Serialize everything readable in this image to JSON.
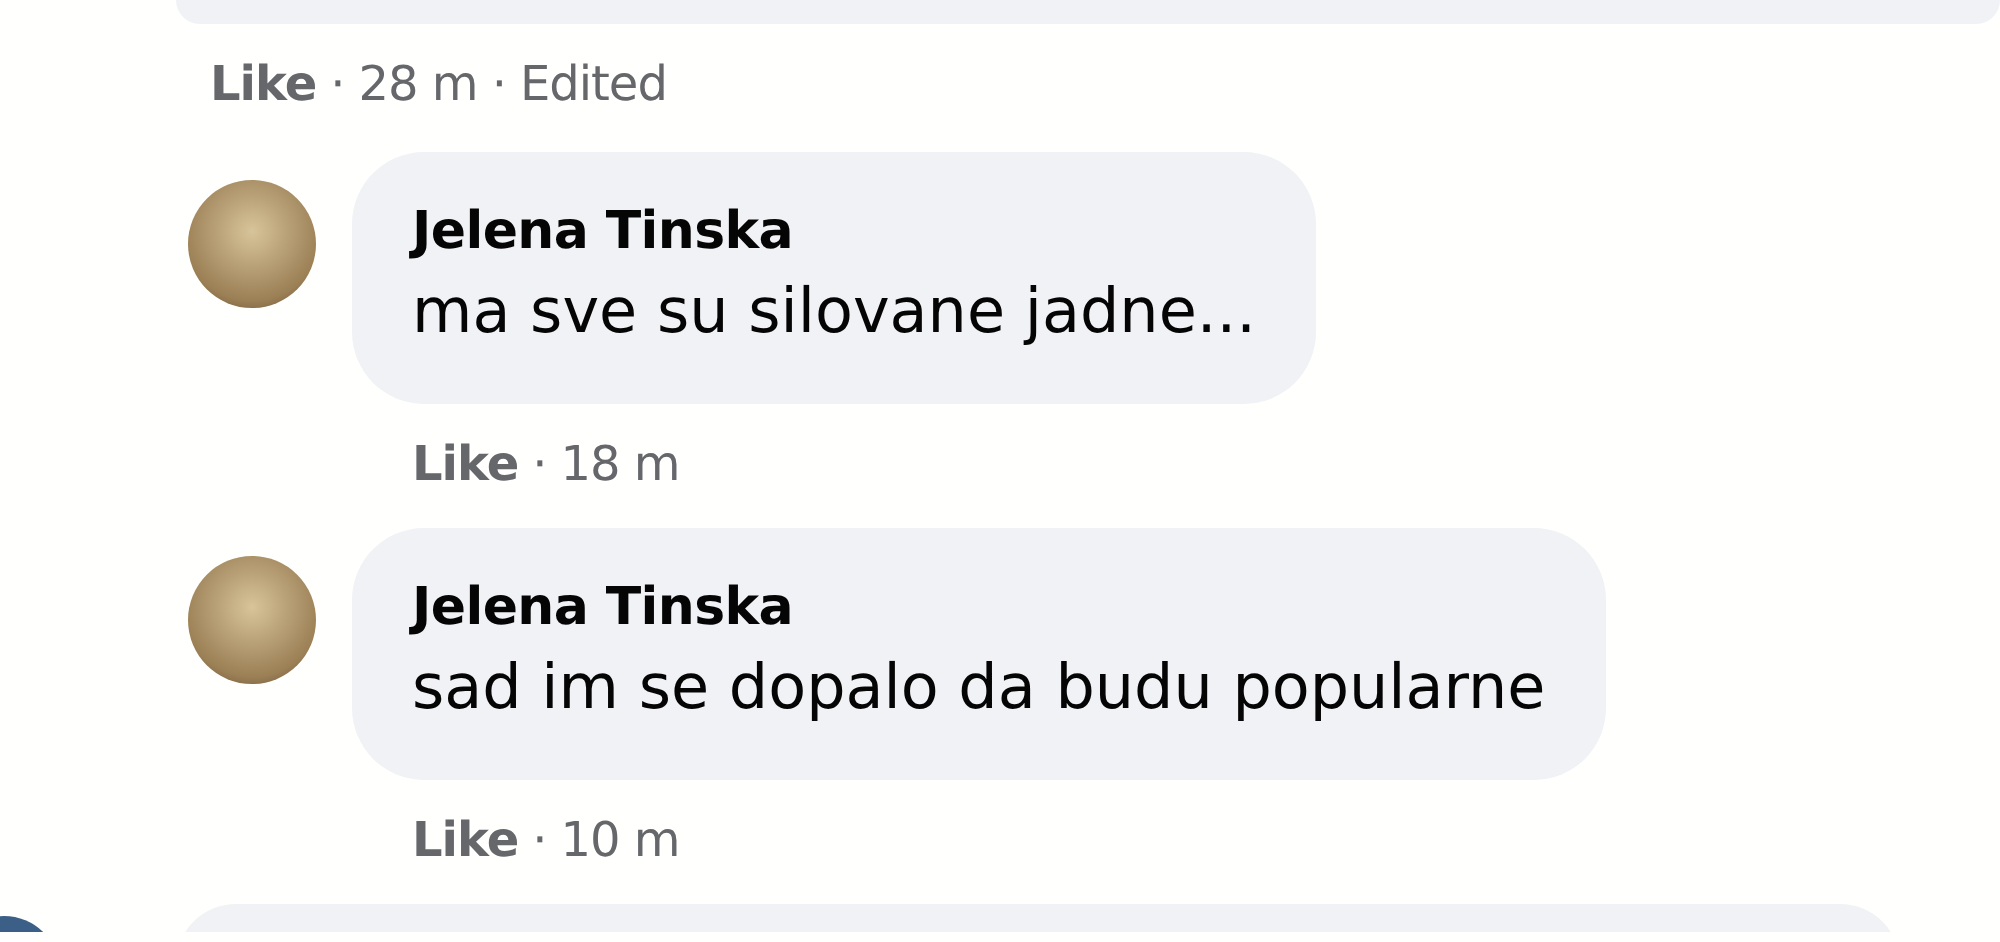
{
  "top_comment": {
    "like": "Like",
    "separator": "·",
    "time": "28 m",
    "edited_separator": "·",
    "edited": "Edited"
  },
  "comments": [
    {
      "author": "Jelena Tinska",
      "text": "ma sve su silovane jadne...",
      "like": "Like",
      "separator": "·",
      "time": "18 m"
    },
    {
      "author": "Jelena Tinska",
      "text": "sad im se dopalo da budu popularne",
      "like": "Like",
      "separator": "·",
      "time": "10 m"
    }
  ]
}
